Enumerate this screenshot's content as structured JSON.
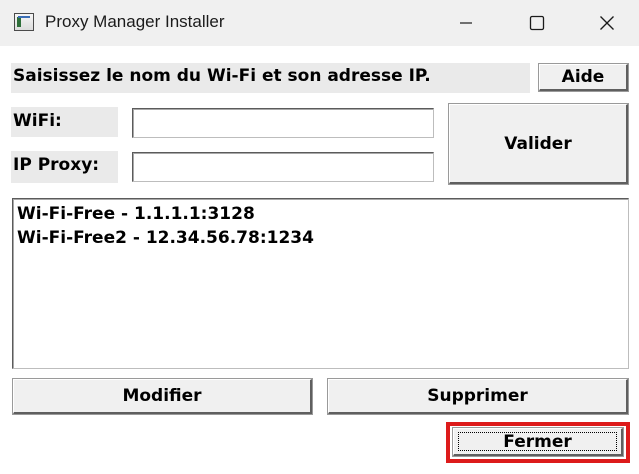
{
  "window": {
    "title": "Proxy Manager Installer",
    "icon": "app-window-icon",
    "controls": [
      "minimize-icon",
      "maximize-icon",
      "close-icon"
    ]
  },
  "instruction": "Saisissez le nom du Wi-Fi et son adresse IP.",
  "buttons": {
    "aide": "Aide",
    "valider": "Valider",
    "modifier": "Modifier",
    "supprimer": "Supprimer",
    "fermer": "Fermer"
  },
  "fields": {
    "wifi": {
      "label": "WiFi:",
      "value": ""
    },
    "ip_proxy": {
      "label": "IP Proxy:",
      "value": ""
    }
  },
  "list": {
    "items": [
      "Wi-Fi-Free - 1.1.1.1:3128",
      "Wi-Fi-Free2 - 12.34.56.78:1234"
    ]
  },
  "colors": {
    "highlight": "#dd1b1b",
    "label_bg": "#eaeaea",
    "button_bg": "#f0f0f0"
  }
}
